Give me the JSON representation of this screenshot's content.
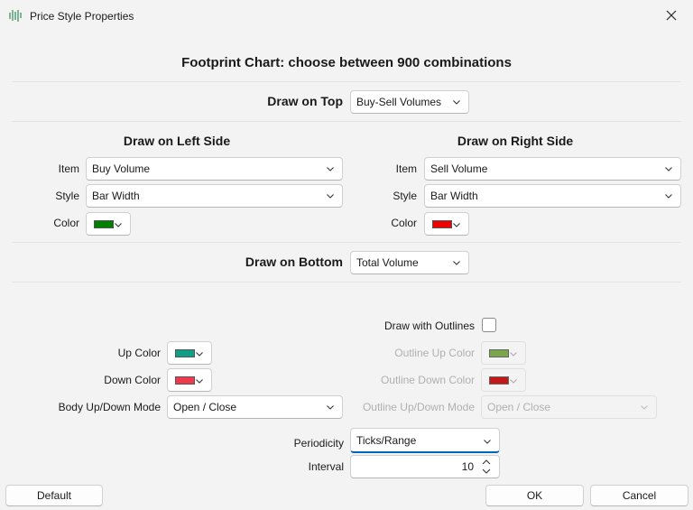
{
  "window": {
    "title": "Price Style Properties"
  },
  "main": {
    "heading": "Footprint Chart: choose between 900 combinations",
    "top": {
      "label": "Draw on Top",
      "value": "Buy-Sell Volumes"
    },
    "left": {
      "heading": "Draw on Left Side",
      "item_label": "Item",
      "item_value": "Buy Volume",
      "style_label": "Style",
      "style_value": "Bar Width",
      "color_label": "Color",
      "color": "#008000"
    },
    "right": {
      "heading": "Draw on Right Side",
      "item_label": "Item",
      "item_value": "Sell Volume",
      "style_label": "Style",
      "style_value": "Bar Width",
      "color_label": "Color",
      "color": "#ee0000"
    },
    "bottom": {
      "label": "Draw on Bottom",
      "value": "Total Volume"
    },
    "outlines": {
      "draw_label": "Draw with Outlines",
      "checked": false,
      "up_label": "Outline Up Color",
      "up_color": "#6f9f3a",
      "down_label": "Outline Down Color",
      "down_color": "#c00000",
      "mode_label": "Outline Up/Down Mode",
      "mode_value": "Open / Close"
    },
    "body": {
      "up_label": "Up Color",
      "up_color": "#119e87",
      "down_label": "Down Color",
      "down_color": "#ef3a4d",
      "mode_label": "Body Up/Down Mode",
      "mode_value": "Open / Close"
    },
    "periodicity": {
      "label": "Periodicity",
      "value": "Ticks/Range"
    },
    "interval": {
      "label": "Interval",
      "value": "10"
    }
  },
  "footer": {
    "default_label": "Default",
    "ok_label": "OK",
    "cancel_label": "Cancel"
  },
  "icons": {
    "app": "bar-chart-icon",
    "close": "close-icon",
    "dropdown": "chevron-down-icon",
    "spinner": "up-down-arrows-icon"
  }
}
